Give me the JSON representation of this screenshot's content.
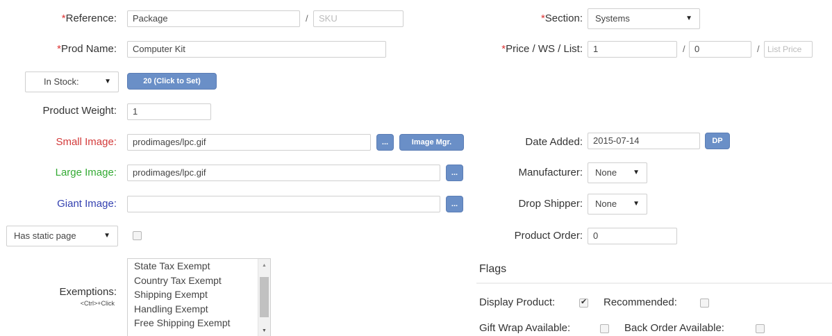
{
  "reference": {
    "label_star": "*",
    "label_text": "Reference:",
    "value": "Package",
    "sep": "/",
    "sku_placeholder": "SKU"
  },
  "section": {
    "label_star": "*",
    "label_text": "Section:",
    "value": "Systems",
    "arrow": "▼"
  },
  "prod_name": {
    "label_star": "*",
    "label_text": "Prod Name:",
    "value": "Computer Kit"
  },
  "price": {
    "label_star": "*",
    "label_text": "Price / WS / List:",
    "price_value": "1",
    "sep1": "/",
    "ws_value": "0",
    "sep2": "/",
    "list_placeholder": "List Price"
  },
  "stock": {
    "select_value": "In Stock:",
    "arrow": "▼",
    "button_label": "20 (Click to Set)"
  },
  "weight": {
    "label": "Product Weight:",
    "value": "1"
  },
  "small_image": {
    "label": "Small Image:",
    "value": "prodimages/lpc.gif",
    "browse_label": "...",
    "mgr_label": "Image Mgr.",
    "label_color": "#d33a3a"
  },
  "large_image": {
    "label": "Large Image:",
    "value": "prodimages/lpc.gif",
    "browse_label": "...",
    "label_color": "#33aa33"
  },
  "giant_image": {
    "label": "Giant Image:",
    "value": "",
    "browse_label": "...",
    "label_color": "#3340b0"
  },
  "date_added": {
    "label": "Date Added:",
    "value": "2015-07-14",
    "button_label": "DP"
  },
  "manufacturer": {
    "label": "Manufacturer:",
    "value": "None",
    "arrow": "▼"
  },
  "drop_shipper": {
    "label": "Drop Shipper:",
    "value": "None",
    "arrow": "▼"
  },
  "static_page": {
    "select_value": "Has static page",
    "arrow": "▼",
    "checked": false
  },
  "product_order": {
    "label": "Product Order:",
    "value": "0"
  },
  "exemptions": {
    "label": "Exemptions:",
    "hint": "<Ctrl>+Click",
    "options": [
      "State Tax Exempt",
      "Country Tax Exempt",
      "Shipping Exempt",
      "Handling Exempt",
      "Free Shipping Exempt"
    ],
    "scroll_up": "▲",
    "scroll_down": "▼"
  },
  "flags": {
    "heading": "Flags",
    "display_product": {
      "label": "Display Product:",
      "checked": true
    },
    "recommended": {
      "label": "Recommended:",
      "checked": false
    },
    "gift_wrap": {
      "label": "Gift Wrap Available:",
      "checked": false
    },
    "back_order": {
      "label": "Back Order Available:",
      "checked": false
    }
  }
}
